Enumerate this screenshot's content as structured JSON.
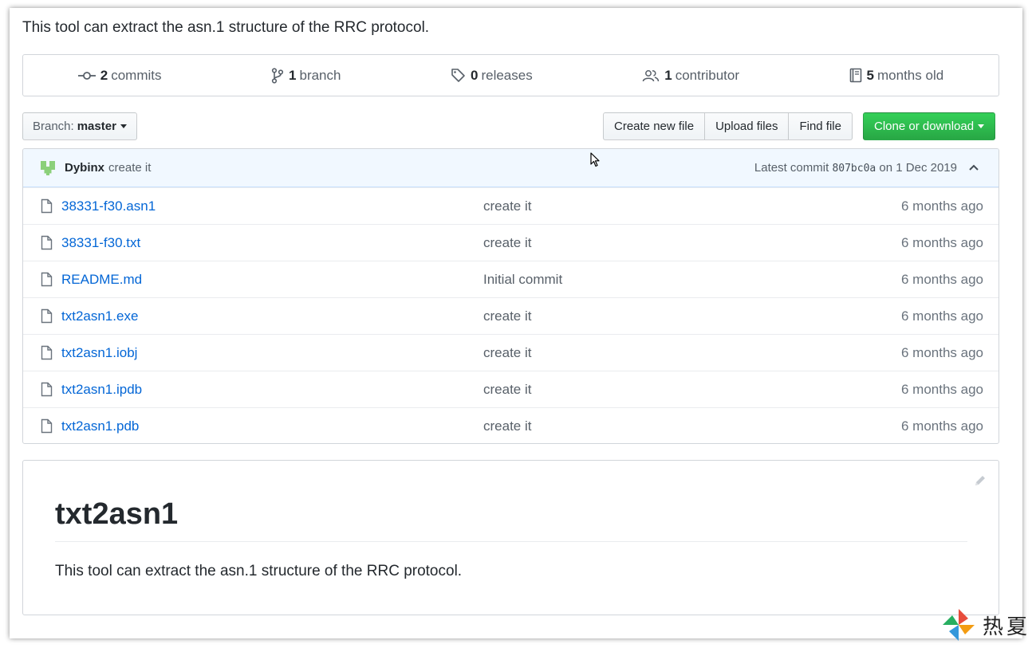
{
  "repo": {
    "description": "This tool can extract the asn.1 structure of the RRC protocol."
  },
  "summary": {
    "commits": {
      "count": "2",
      "label": "commits"
    },
    "branches": {
      "count": "1",
      "label": "branch"
    },
    "releases": {
      "count": "0",
      "label": "releases"
    },
    "contributors": {
      "count": "1",
      "label": "contributor"
    },
    "age": {
      "count": "5",
      "label": "months old"
    }
  },
  "toolbar": {
    "branch_label": "Branch:",
    "branch_value": "master",
    "create_new_file": "Create new file",
    "upload_files": "Upload files",
    "find_file": "Find file",
    "clone_or_download": "Clone or download"
  },
  "commit": {
    "author": "Dybinx",
    "message": "create it",
    "latest_prefix": "Latest commit",
    "sha": "807bc0a",
    "date_text": "on 1 Dec 2019"
  },
  "files": [
    {
      "name": "38331-f30.asn1",
      "message": "create it",
      "age": "6 months ago"
    },
    {
      "name": "38331-f30.txt",
      "message": "create it",
      "age": "6 months ago"
    },
    {
      "name": "README.md",
      "message": "Initial commit",
      "age": "6 months ago"
    },
    {
      "name": "txt2asn1.exe",
      "message": "create it",
      "age": "6 months ago"
    },
    {
      "name": "txt2asn1.iobj",
      "message": "create it",
      "age": "6 months ago"
    },
    {
      "name": "txt2asn1.ipdb",
      "message": "create it",
      "age": "6 months ago"
    },
    {
      "name": "txt2asn1.pdb",
      "message": "create it",
      "age": "6 months ago"
    }
  ],
  "readme": {
    "title": "txt2asn1",
    "body": "This tool can extract the asn.1 structure of the RRC protocol."
  },
  "watermark": {
    "text": "热夏"
  },
  "colors": {
    "link": "#0366d6",
    "clone_green": "#28a745",
    "commit_bar_bg": "#f1f8ff"
  },
  "icons": [
    "commit-icon",
    "branch-icon",
    "tag-icon",
    "people-icon",
    "book-icon",
    "file-icon",
    "chevron-up-icon",
    "pencil-icon",
    "caret-down-icon",
    "mouse-cursor-icon"
  ]
}
